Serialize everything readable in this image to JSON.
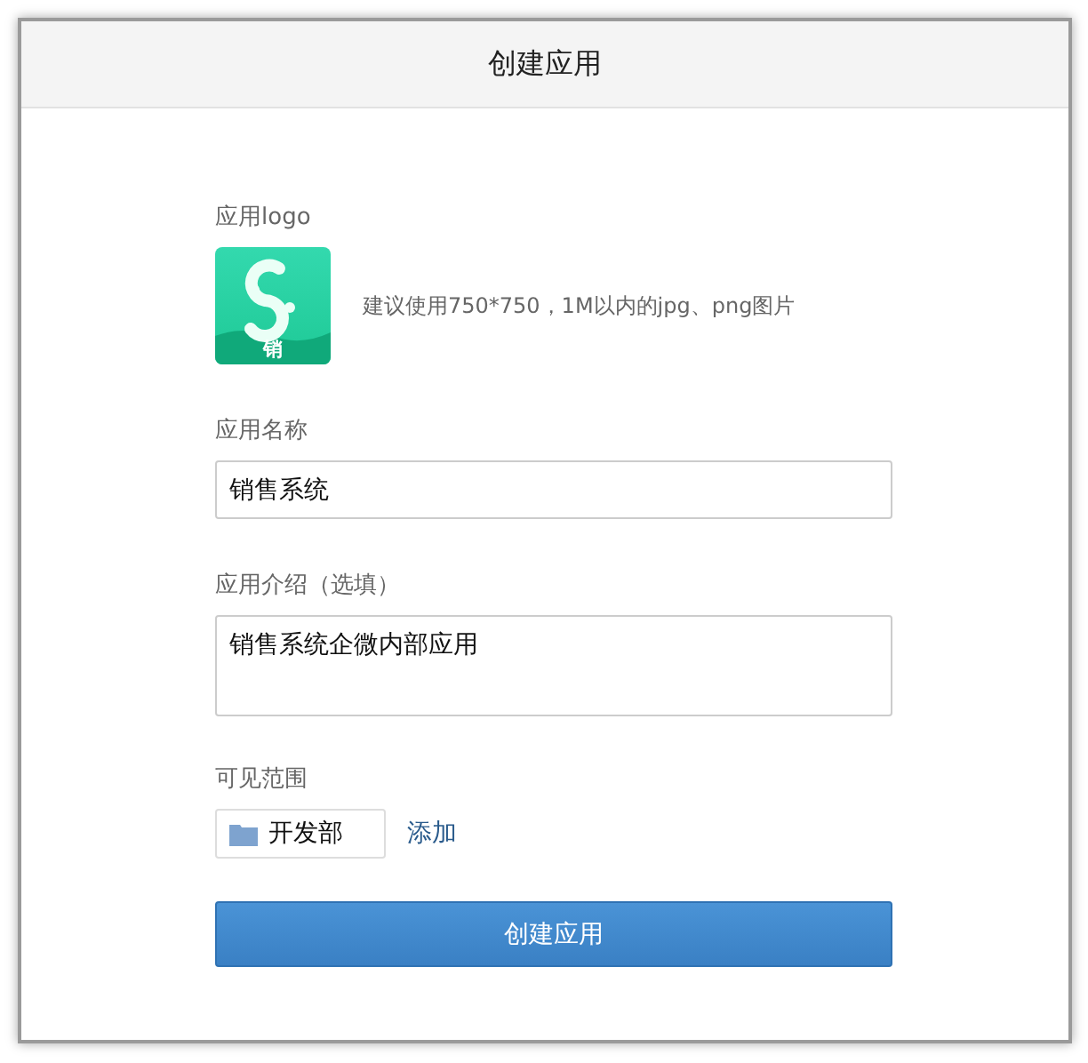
{
  "dialog": {
    "title": "创建应用"
  },
  "logo_section": {
    "label": "应用logo",
    "logo_badge": "销",
    "hint": "建议使用750*750，1M以内的jpg、png图片"
  },
  "name_field": {
    "label": "应用名称",
    "value": "销售系统"
  },
  "intro_field": {
    "label": "应用介绍（选填）",
    "value": "销售系统企微内部应用"
  },
  "visibility": {
    "label": "可见范围",
    "departments": [
      "开发部"
    ],
    "add_link": "添加"
  },
  "submit_button": "创建应用"
}
